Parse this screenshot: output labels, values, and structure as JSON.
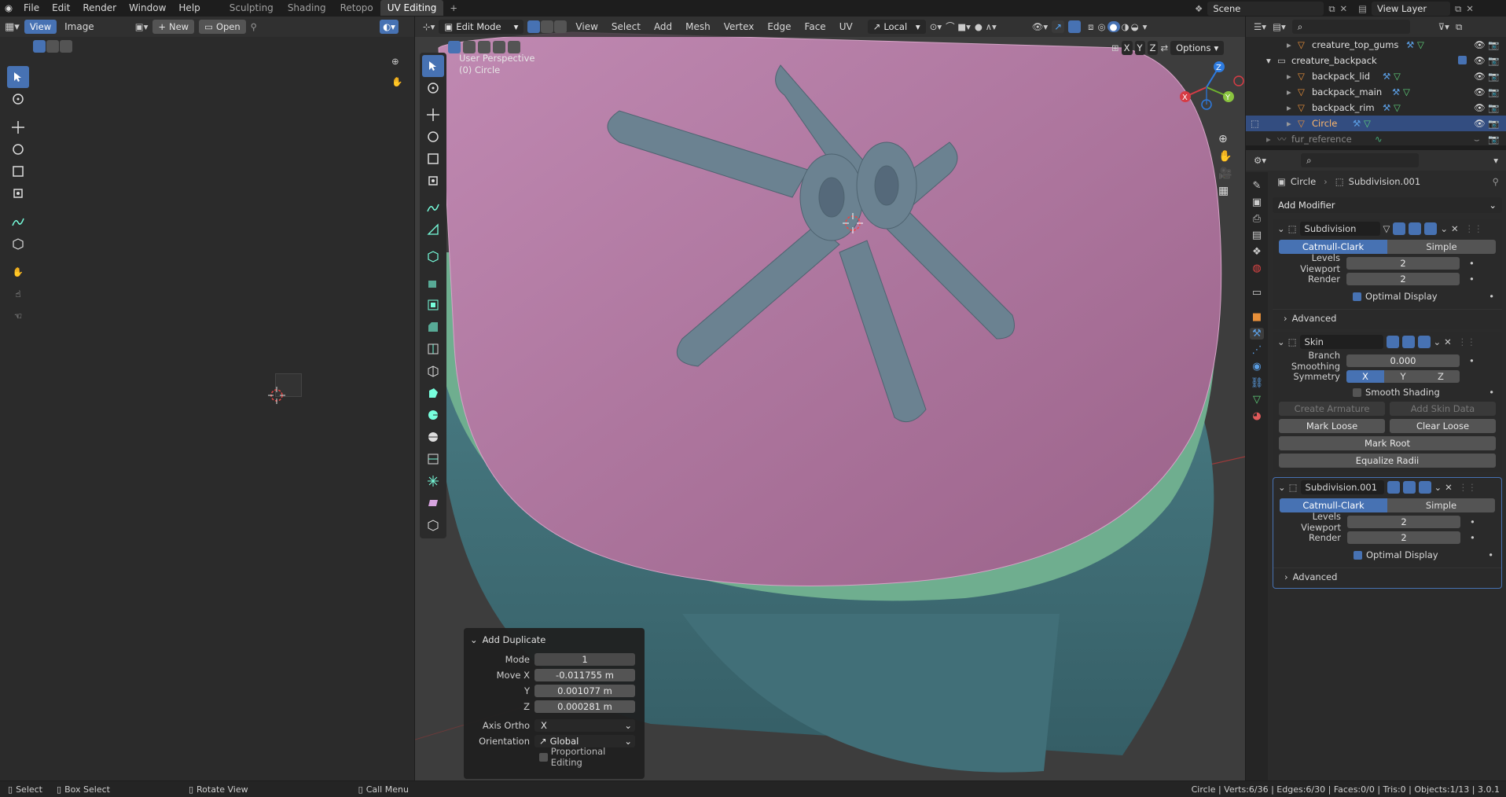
{
  "topbar": {
    "menus": [
      "File",
      "Edit",
      "Render",
      "Window",
      "Help"
    ],
    "workspaces": [
      "Sculpting",
      "Shading",
      "Retopo",
      "UV Editing"
    ],
    "active_workspace": "UV Editing",
    "scene": "Scene",
    "view_layer": "View Layer"
  },
  "uv_editor": {
    "view_label": "View",
    "image_label": "Image",
    "new_label": "New",
    "open_label": "Open"
  },
  "viewport": {
    "mode": "Edit Mode",
    "menus": [
      "View",
      "Select",
      "Add",
      "Mesh",
      "Vertex",
      "Edge",
      "Face",
      "UV"
    ],
    "orientation": "Local",
    "options_label": "Options",
    "axis_locks": [
      "X",
      "Y",
      "Z"
    ],
    "perspective": "User Perspective",
    "object_info": "(0) Circle",
    "gizmo": {
      "x": "X",
      "y": "Y",
      "z": "Z"
    }
  },
  "operator_panel": {
    "title": "Add Duplicate",
    "mode_label": "Mode",
    "mode_value": "1",
    "move_x_label": "Move X",
    "move_x": "-0.011755 m",
    "y_label": "Y",
    "move_y": "0.001077 m",
    "z_label": "Z",
    "move_z": "0.000281 m",
    "axis_ortho_label": "Axis Ortho",
    "axis_ortho": "X",
    "orientation_label": "Orientation",
    "orientation": "Global",
    "proportional_label": "Proportional Editing"
  },
  "outliner": {
    "items": [
      {
        "name": "creature_top_gums"
      },
      {
        "name": "creature_backpack"
      },
      {
        "name": "backpack_lid"
      },
      {
        "name": "backpack_main"
      },
      {
        "name": "backpack_rim"
      },
      {
        "name": "Circle"
      },
      {
        "name": "fur_reference"
      }
    ]
  },
  "properties": {
    "breadcrumb_object": "Circle",
    "breadcrumb_modifier": "Subdivision.001",
    "add_modifier": "Add Modifier",
    "modifiers": [
      {
        "name": "Subdivision",
        "method_a": "Catmull-Clark",
        "method_b": "Simple",
        "levels_label": "Levels Viewport",
        "levels": "2",
        "render_label": "Render",
        "render": "2",
        "optimal": "Optimal Display",
        "advanced": "Advanced"
      },
      {
        "name": "Skin",
        "branch_label": "Branch Smoothing",
        "branch": "0.000",
        "symmetry_label": "Symmetry",
        "sym_x": "X",
        "sym_y": "Y",
        "sym_z": "Z",
        "smooth_shading": "Smooth Shading",
        "create_armature": "Create Armature",
        "add_skin_data": "Add Skin Data",
        "mark_loose": "Mark Loose",
        "clear_loose": "Clear Loose",
        "mark_root": "Mark Root",
        "equalize_radii": "Equalize Radii"
      },
      {
        "name": "Subdivision.001",
        "method_a": "Catmull-Clark",
        "method_b": "Simple",
        "levels_label": "Levels Viewport",
        "levels": "2",
        "render_label": "Render",
        "render": "2",
        "optimal": "Optimal Display",
        "advanced": "Advanced"
      }
    ]
  },
  "statusbar": {
    "select": "Select",
    "box_select": "Box Select",
    "rotate_view": "Rotate View",
    "call_menu": "Call Menu",
    "stats": "Circle | Verts:6/36 | Edges:6/30 | Faces:0/0 | Tris:0 | Objects:1/13 | 3.0.1"
  },
  "colors": {
    "accent": "#4772b3",
    "lid": "#b57aa6",
    "rim": "#6fae8f",
    "body": "#5e8f96",
    "skin_mesh": "#6b8291"
  }
}
